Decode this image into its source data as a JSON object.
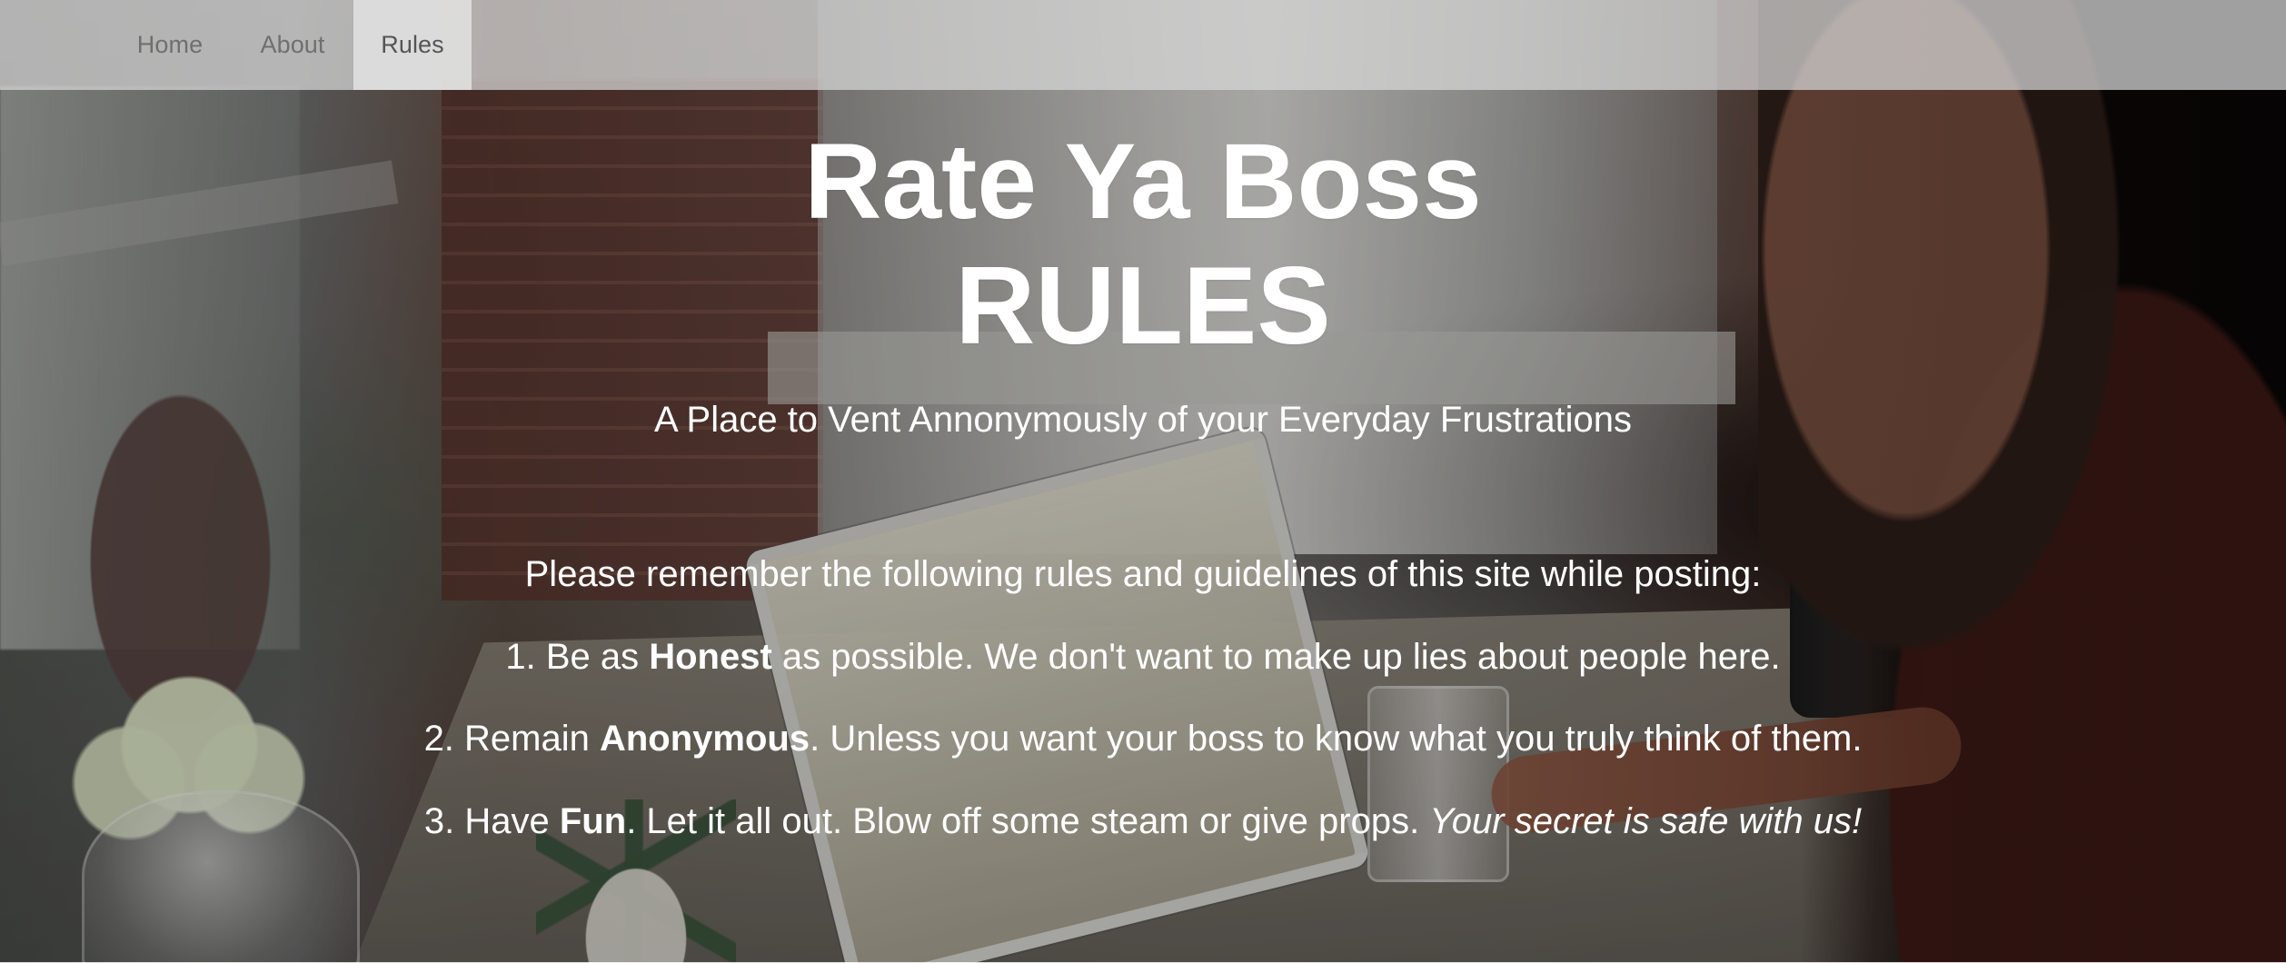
{
  "nav": {
    "items": [
      {
        "label": "Home",
        "active": false
      },
      {
        "label": "About",
        "active": false
      },
      {
        "label": "Rules",
        "active": true
      }
    ]
  },
  "hero": {
    "title": "Rate Ya Boss",
    "heading": "RULES",
    "subtitle": "A Place to Vent Annonymously of your Everyday Frustrations"
  },
  "rules": {
    "intro": "Please remember the following rules and guidelines of this site while posting:",
    "items": [
      {
        "prefix": "1. Be as ",
        "emphasis": "Honest",
        "suffix": " as possible. We don't want to make up lies about people here."
      },
      {
        "prefix": "2. Remain ",
        "emphasis": "Anonymous",
        "suffix": ". Unless you want your boss to know what you truly think of them."
      },
      {
        "prefix": "3. Have ",
        "emphasis": "Fun",
        "suffix": ". Let it all out. Blow off some steam or give props. ",
        "italic": "Your secret is safe with us!"
      }
    ]
  },
  "colors": {
    "nav_background": "#d6d6d6",
    "nav_active_background": "#e4e4e4",
    "nav_text": "#6f6f6f",
    "hero_text": "#ffffff"
  }
}
